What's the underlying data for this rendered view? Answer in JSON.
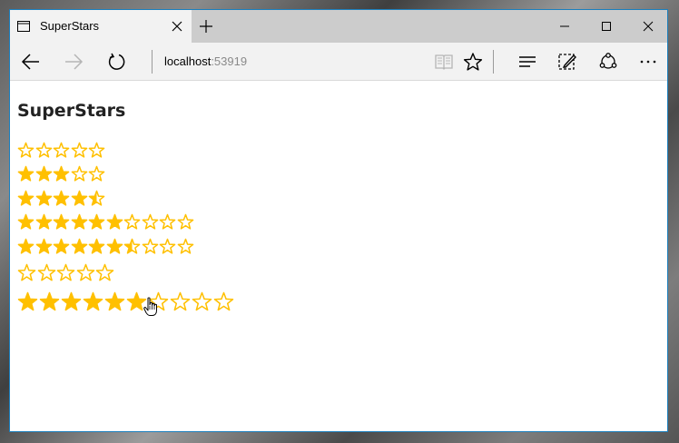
{
  "browser": {
    "tab_title": "SuperStars",
    "address_host": "localhost",
    "address_port": ":53919"
  },
  "page": {
    "heading": "SuperStars"
  },
  "colors": {
    "star_fill": "#FFC000",
    "star_outline": "#FFC000",
    "window_border": "#1b7fbd"
  },
  "icons": [
    "tab-page-icon",
    "close-icon",
    "plus-icon",
    "minimize-icon",
    "maximize-icon",
    "window-close-icon",
    "back-arrow-icon",
    "forward-arrow-icon",
    "refresh-icon",
    "reading-view-icon",
    "favorite-star-icon",
    "hub-icon",
    "web-note-icon",
    "share-icon",
    "more-icon",
    "hand-pointer-icon"
  ],
  "ratings": [
    {
      "value": 0,
      "max": 5
    },
    {
      "value": 3,
      "max": 5
    },
    {
      "value": 4.5,
      "max": 5
    },
    {
      "value": 6,
      "max": 10
    },
    {
      "value": 6.5,
      "max": 10
    },
    {
      "value": 0,
      "max": 5
    },
    {
      "value": 6,
      "max": 10
    }
  ]
}
